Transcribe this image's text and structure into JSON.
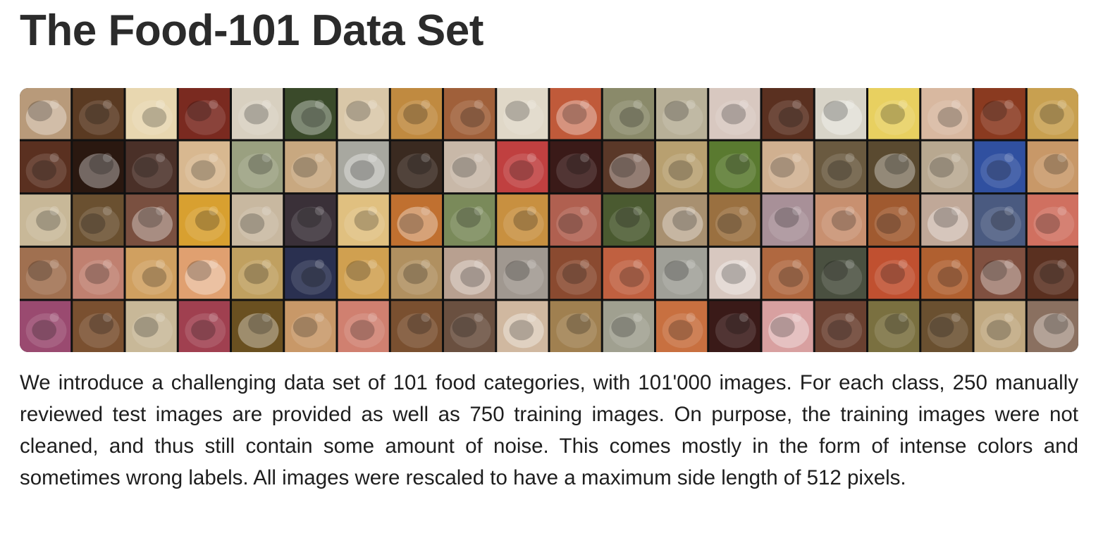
{
  "page": {
    "title": "The Food-101 Data Set",
    "description": "We introduce a challenging data set of 101 food categories, with 101'000 images. For each class, 250 manually reviewed test images are provided as well as 750 training images. On purpose, the training images were not cleaned, and thus still contain some amount of noise. This comes mostly in the form of intense colors and sometimes wrong labels. All images were rescaled to have a maximum side length of 512 pixels."
  },
  "mosaic": {
    "rows": 5,
    "columns": 20,
    "tile_colors": [
      [
        "#b89a7a",
        "#5a3a22",
        "#e8d7b0",
        "#7a2a20",
        "#d8d0c0",
        "#3a4a2a",
        "#d9c7a8",
        "#c08a40",
        "#a0603a",
        "#e0d8c8",
        "#c05a3a",
        "#8a8a6a",
        "#b8b098",
        "#d8c8c0",
        "#5a3020",
        "#d8d4c8",
        "#e8d060",
        "#d8b8a0",
        "#8a3a20",
        "#c8a050"
      ],
      [
        "#5a3020",
        "#2a1810",
        "#4a3028",
        "#d8b890",
        "#9aa080",
        "#c8a880",
        "#a8a8a0",
        "#3a2a20",
        "#c8b8a8",
        "#c04040",
        "#3a1a18",
        "#5a3828",
        "#b8a070",
        "#5a7a30",
        "#d0b090",
        "#6a5a40",
        "#5a4a30",
        "#b8a890",
        "#3050a0",
        "#c89868"
      ],
      [
        "#c8b898",
        "#6a5030",
        "#7a5040",
        "#d8a030",
        "#c8b8a0",
        "#3a3038",
        "#e0c080",
        "#c07030",
        "#7a8a5a",
        "#c89040",
        "#b06050",
        "#4a5a30",
        "#a89070",
        "#9a7040",
        "#a89098",
        "#c89070",
        "#a05a30",
        "#c0a898",
        "#4a5a80",
        "#d07060"
      ],
      [
        "#a07050",
        "#c08070",
        "#d0a060",
        "#e0a070",
        "#c0a060",
        "#2a3050",
        "#d0a050",
        "#b09060",
        "#b8a090",
        "#a09890",
        "#8a4a30",
        "#c06040",
        "#a0a098",
        "#d8c8c0",
        "#b06840",
        "#4a5040",
        "#c05030",
        "#b06030",
        "#805040",
        "#5a3020"
      ],
      [
        "#9a4a70",
        "#7a5030",
        "#c8b898",
        "#a04050",
        "#6a5020",
        "#c89868",
        "#d08070",
        "#7a5030",
        "#6a5040",
        "#d0b8a0",
        "#a08050",
        "#a0a090",
        "#c87040",
        "#3a1a18",
        "#d8a0a0",
        "#6a4030",
        "#7a7040",
        "#6a5030",
        "#c0a880",
        "#8a7060"
      ]
    ]
  }
}
